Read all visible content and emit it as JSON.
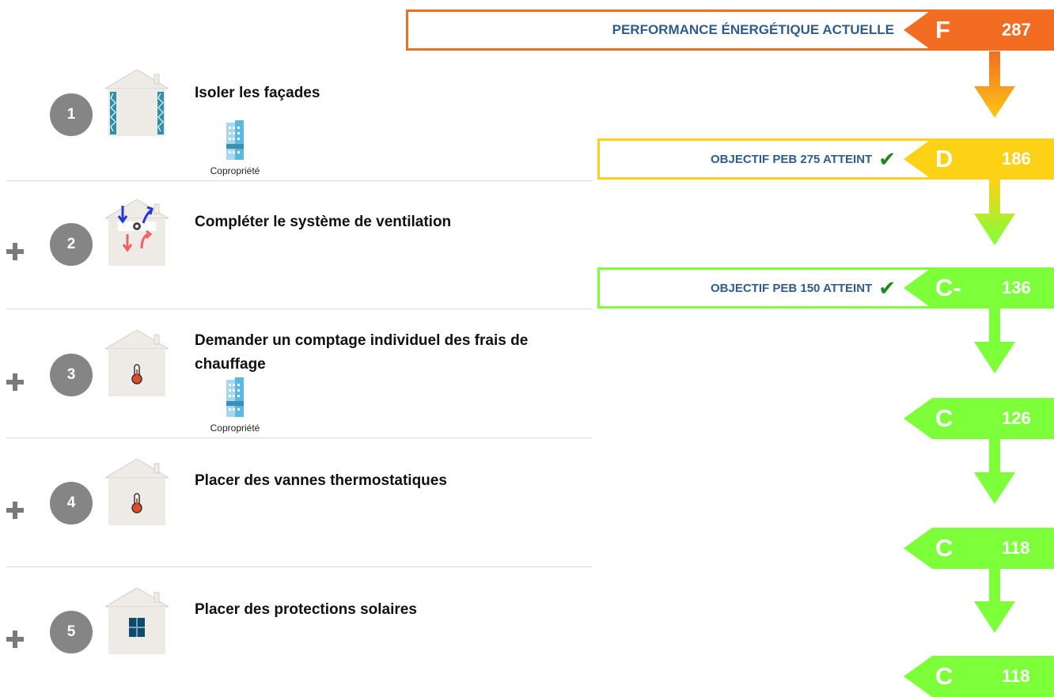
{
  "initial": {
    "label": "PERFORMANCE ÉNERGÉTIQUE ACTUELLE",
    "class": "F",
    "value": "287",
    "color": "#f26d22"
  },
  "steps": [
    {
      "number": "1",
      "title": "Isoler les façades",
      "prefix": "",
      "copropriete": "Copropriété",
      "icon": "house-insulation-icon"
    },
    {
      "number": "2",
      "title": "Compléter le système de ventilation",
      "prefix": "+",
      "copropriete": "",
      "icon": "house-ventilation-icon"
    },
    {
      "number": "3",
      "title": "Demander un comptage individuel des frais de chauffage",
      "prefix": "+",
      "copropriete": "Copropriété",
      "icon": "house-thermometer-icon"
    },
    {
      "number": "4",
      "title": "Placer des vannes thermostatiques",
      "prefix": "+",
      "copropriete": "",
      "icon": "house-thermometer-icon"
    },
    {
      "number": "5",
      "title": "Placer des protections solaires",
      "prefix": "+",
      "copropriete": "",
      "icon": "house-window-icon"
    }
  ],
  "results": [
    {
      "label": "OBJECTIF PEB 275 ATTEINT",
      "class": "D",
      "value": "186",
      "color": "#fdd116"
    },
    {
      "label": "OBJECTIF PEB 150 ATTEINT",
      "class": "C-",
      "value": "136",
      "color": "#7dff3a"
    },
    {
      "label": "",
      "class": "C",
      "value": "126",
      "color": "#7dff3a"
    },
    {
      "label": "",
      "class": "C",
      "value": "118",
      "color": "#7dff3a"
    },
    {
      "label": "",
      "class": "C",
      "value": "118",
      "color": "#7dff3a"
    }
  ],
  "colors": {
    "circle": "#858585",
    "label_text": "#2f5c8c",
    "check": "#1e8a1e",
    "orange": "#f26d22",
    "yellow": "#fdd116",
    "green": "#7dff3a"
  }
}
